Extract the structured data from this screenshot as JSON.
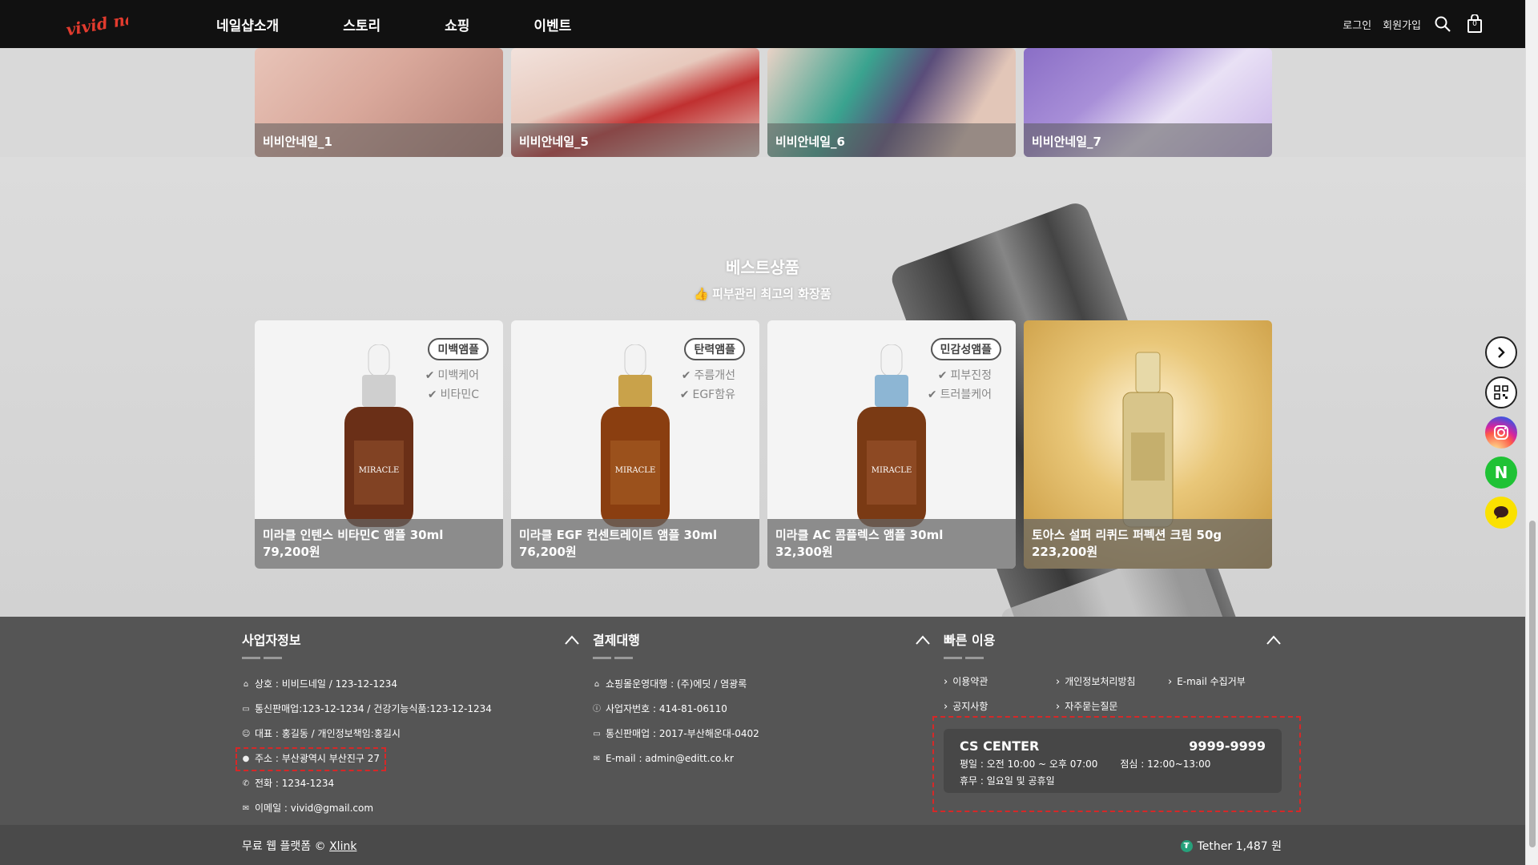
{
  "header": {
    "logo_text": "vivid nail",
    "nav": [
      "네일샵소개",
      "스토리",
      "쇼핑",
      "이벤트"
    ],
    "login": "로그인",
    "signup": "회원가입",
    "cart_count": "0"
  },
  "gallery": [
    {
      "caption": "비비안네일_1",
      "color": "#d9a89b"
    },
    {
      "caption": "비비안네일_5",
      "color": "#c03030"
    },
    {
      "caption": "비비안네일_6",
      "color": "#3aa38f"
    },
    {
      "caption": "비비안네일_7",
      "color": "#a88fd8"
    }
  ],
  "best": {
    "title": "베스트상품",
    "subtitle": "피부관리 최고의 화장품",
    "products": [
      {
        "badge": "미백앰플",
        "features": [
          "미백케어",
          "비타민C"
        ],
        "name": "미라클 인텐스 비타민C 앰플 30ml",
        "price": "79,200원",
        "cap_color": "#cfcfcf"
      },
      {
        "badge": "탄력앰플",
        "features": [
          "주름개선",
          "EGF함유"
        ],
        "name": "미라클 EGF 컨센트레이트 앰플 30ml",
        "price": "76,200원",
        "cap_color": "#c9a24a"
      },
      {
        "badge": "민감성앰플",
        "features": [
          "피부진정",
          "트러블케어"
        ],
        "name": "미라클 AC 콤플렉스 앰플 30ml",
        "price": "32,300원",
        "cap_color": "#8db6d4"
      },
      {
        "badge": "",
        "features": [],
        "name": "토아스 설퍼 리퀴드 퍼펙션 크림 50g",
        "price": "223,200원",
        "cap_color": "#d8c58a"
      }
    ]
  },
  "footer": {
    "biz": {
      "title": "사업자정보",
      "items": [
        "상호 : 비비드네일 / 123-12-1234",
        "통신판매업:123-12-1234 / 건강기능식품:123-12-1234",
        "대표 : 홍길동 / 개인정보책임:홍길시",
        "주소 : 부산광역시 부산진구 27",
        "전화 : 1234-1234",
        "이메일 : vivid@gmail.com"
      ]
    },
    "pay": {
      "title": "결제대행",
      "items": [
        "쇼핑몰운영대행 : (주)에딧 / 염광록",
        "사업자번호 : 414-81-06110",
        "통신판매업 : 2017-부산해운대-0402",
        "E-mail : admin@editt.co.kr"
      ]
    },
    "quick": {
      "title": "빠른 이용",
      "links": [
        "이용약관",
        "개인정보처리방침",
        "E-mail 수집거부",
        "공지사항",
        "자주묻는질문"
      ]
    },
    "cs": {
      "title": "CS CENTER",
      "phone": "9999-9999",
      "hours": "평일 : 오전 10:00 ~ 오후 07:00",
      "lunch": "점심 : 12:00~13:00",
      "holiday": "휴무 : 일요일 및 공휴일"
    },
    "copyright_prefix": "무료 웹 플랫폼 © ",
    "copyright_link": "Xlink",
    "tether": "Tether 1,487 원"
  }
}
